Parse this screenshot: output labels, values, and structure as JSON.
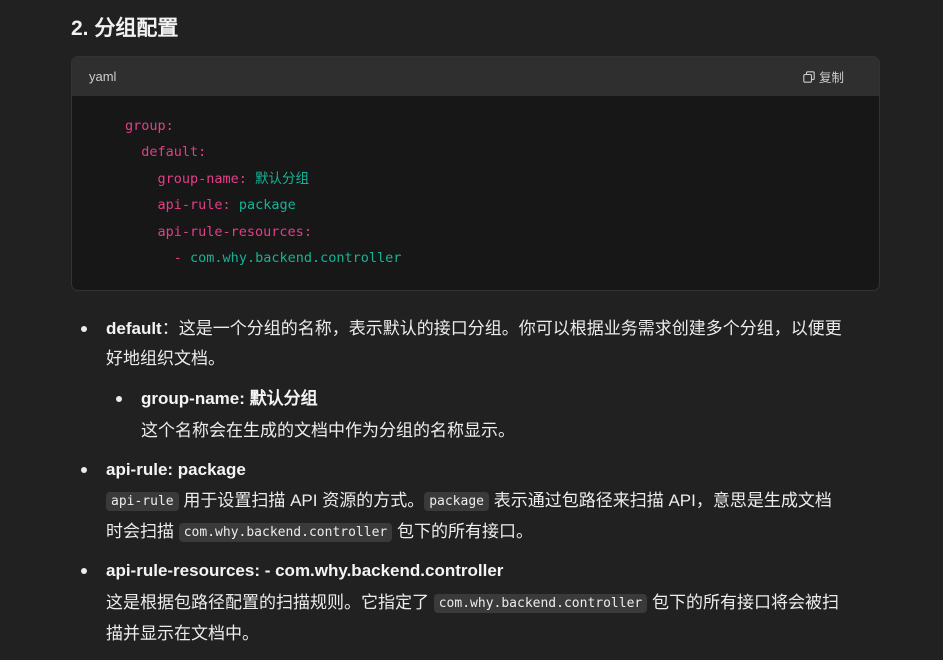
{
  "section": {
    "title": "2. 分组配置"
  },
  "code_block": {
    "language": "yaml",
    "copy_label": "复制",
    "lines": [
      {
        "key": "group:",
        "value": ""
      },
      {
        "key": "default:",
        "value": ""
      },
      {
        "key": "group-name:",
        "value": "默认分组"
      },
      {
        "key": "api-rule:",
        "value": "package"
      },
      {
        "key": "api-rule-resources:",
        "value": ""
      },
      {
        "key": "- ",
        "value": "com.why.backend.controller"
      }
    ]
  },
  "items": {
    "default": {
      "term": "default",
      "text_line1": "：这是一个分组的名称，表示默认的接口分组。你可以根据业务需求创建多个分组，以便更",
      "text_line2": "好地组织文档。"
    },
    "group_name": {
      "term": "group-name: 默认分组",
      "text": "这个名称会在生成的文档中作为分组的名称显示。"
    },
    "api_rule": {
      "term": "api-rule: package",
      "code1": "api-rule",
      "text1": " 用于设置扫描 API 资源的方式。",
      "code2": "package",
      "text2": " 表示通过包路径来扫描 API，意思是生成文档",
      "text3": "时会扫描 ",
      "code3": "com.why.backend.controller",
      "text4": " 包下的所有接口。"
    },
    "api_rule_resources": {
      "term": "api-rule-resources: - com.why.backend.controller",
      "text1": "这是根据包路径配置的扫描规则。它指定了 ",
      "code1": "com.why.backend.controller",
      "text2": " 包下的所有接口将会被扫",
      "text3": "描并显示在文档中。"
    }
  },
  "colors": {
    "background": "#212121",
    "code_bg": "#171717",
    "code_header_bg": "#2f2f2f",
    "yaml_key": "#e33f88",
    "yaml_value": "#15b396"
  }
}
